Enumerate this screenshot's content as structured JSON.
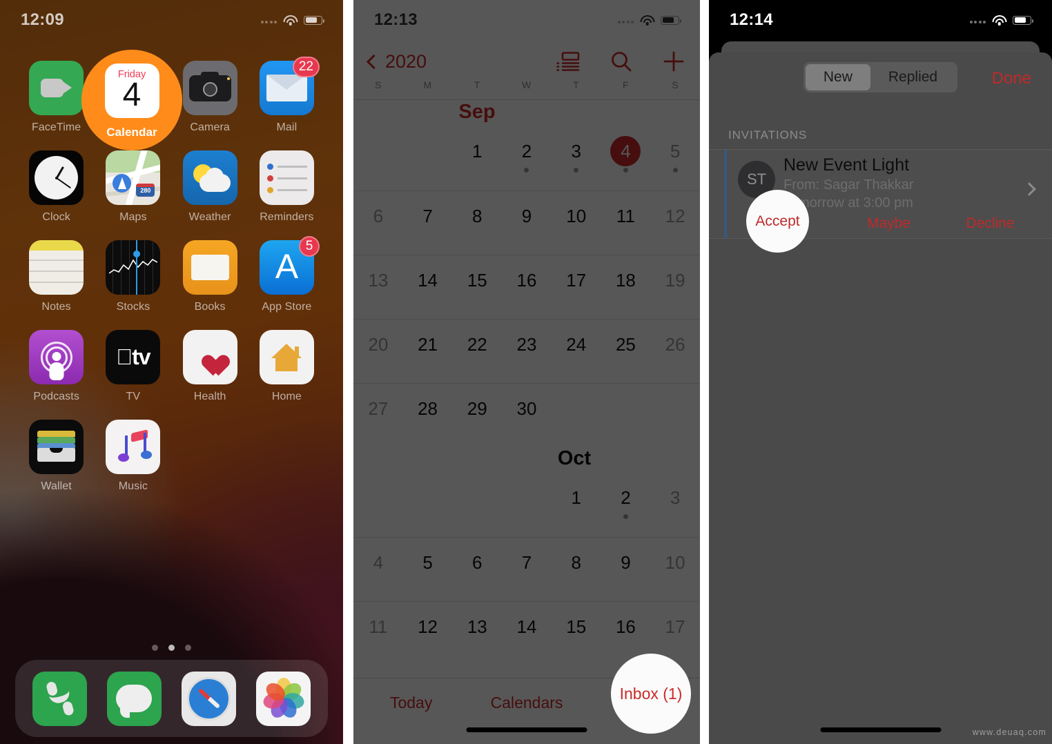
{
  "panel1": {
    "statusbar": {
      "time": "12:09",
      "wifi_icon": "wifi-icon",
      "battery_icon": "battery-icon",
      "signal_icon": "signal-dots-icon"
    },
    "apps": [
      {
        "name": "FaceTime",
        "icon": "facetime-icon"
      },
      {
        "name": "Calendar",
        "icon": "calendar-icon",
        "cal_day": "Friday",
        "cal_num": "4",
        "highlighted": true
      },
      {
        "name": "Camera",
        "icon": "camera-icon"
      },
      {
        "name": "Mail",
        "icon": "mail-icon",
        "badge": "22"
      },
      {
        "name": "Clock",
        "icon": "clock-icon"
      },
      {
        "name": "Maps",
        "icon": "maps-icon",
        "shield": "280"
      },
      {
        "name": "Weather",
        "icon": "weather-icon"
      },
      {
        "name": "Reminders",
        "icon": "reminders-icon"
      },
      {
        "name": "Notes",
        "icon": "notes-icon"
      },
      {
        "name": "Stocks",
        "icon": "stocks-icon"
      },
      {
        "name": "Books",
        "icon": "books-icon"
      },
      {
        "name": "App Store",
        "icon": "appstore-icon",
        "badge": "5"
      },
      {
        "name": "Podcasts",
        "icon": "podcasts-icon"
      },
      {
        "name": "TV",
        "icon": "tv-icon",
        "glyph": "tv"
      },
      {
        "name": "Health",
        "icon": "health-icon"
      },
      {
        "name": "Home",
        "icon": "home-icon"
      },
      {
        "name": "Wallet",
        "icon": "wallet-icon"
      },
      {
        "name": "Music",
        "icon": "music-icon"
      }
    ],
    "page_dots": {
      "count": 3,
      "active_index": 1
    },
    "dock": [
      {
        "name": "Phone",
        "icon": "phone-icon"
      },
      {
        "name": "Messages",
        "icon": "messages-icon"
      },
      {
        "name": "Safari",
        "icon": "safari-icon"
      },
      {
        "name": "Photos",
        "icon": "photos-icon"
      }
    ],
    "highlight": {
      "target": "Calendar",
      "color": "#ff8c1a"
    }
  },
  "panel2": {
    "statusbar": {
      "time": "12:13"
    },
    "nav": {
      "back_label": "2020",
      "back_icon": "chevron-left-icon",
      "list_view_icon": "agenda-list-icon",
      "search_icon": "search-icon",
      "add_icon": "plus-icon"
    },
    "weekdays": [
      "S",
      "M",
      "T",
      "W",
      "T",
      "F",
      "S"
    ],
    "months": [
      {
        "name": "Sep",
        "accent": true,
        "weeks": [
          [
            {
              "n": "",
              "dim": false
            },
            {
              "n": "",
              "dim": false
            },
            {
              "n": "1",
              "dim": false
            },
            {
              "n": "2",
              "dim": false,
              "dot": true
            },
            {
              "n": "3",
              "dim": false,
              "dot": true
            },
            {
              "n": "4",
              "dim": false,
              "dot": true,
              "today": true
            },
            {
              "n": "5",
              "dim": true,
              "dot": true
            }
          ],
          [
            {
              "n": "6",
              "dim": true
            },
            {
              "n": "7",
              "dim": false
            },
            {
              "n": "8",
              "dim": false
            },
            {
              "n": "9",
              "dim": false
            },
            {
              "n": "10",
              "dim": false
            },
            {
              "n": "11",
              "dim": false
            },
            {
              "n": "12",
              "dim": true
            }
          ],
          [
            {
              "n": "13",
              "dim": true
            },
            {
              "n": "14",
              "dim": false
            },
            {
              "n": "15",
              "dim": false
            },
            {
              "n": "16",
              "dim": false
            },
            {
              "n": "17",
              "dim": false
            },
            {
              "n": "18",
              "dim": false
            },
            {
              "n": "19",
              "dim": true
            }
          ],
          [
            {
              "n": "20",
              "dim": true
            },
            {
              "n": "21",
              "dim": false
            },
            {
              "n": "22",
              "dim": false
            },
            {
              "n": "23",
              "dim": false
            },
            {
              "n": "24",
              "dim": false
            },
            {
              "n": "25",
              "dim": false
            },
            {
              "n": "26",
              "dim": true
            }
          ],
          [
            {
              "n": "27",
              "dim": true
            },
            {
              "n": "28",
              "dim": false
            },
            {
              "n": "29",
              "dim": false
            },
            {
              "n": "30",
              "dim": false
            },
            {
              "n": "",
              "dim": false
            },
            {
              "n": "",
              "dim": false
            },
            {
              "n": "",
              "dim": false
            }
          ]
        ]
      },
      {
        "name": "Oct",
        "accent": false,
        "weeks": [
          [
            {
              "n": "",
              "dim": false
            },
            {
              "n": "",
              "dim": false
            },
            {
              "n": "",
              "dim": false
            },
            {
              "n": "",
              "dim": false
            },
            {
              "n": "1",
              "dim": false
            },
            {
              "n": "2",
              "dim": false,
              "dot": true
            },
            {
              "n": "3",
              "dim": true
            }
          ],
          [
            {
              "n": "4",
              "dim": true
            },
            {
              "n": "5",
              "dim": false
            },
            {
              "n": "6",
              "dim": false
            },
            {
              "n": "7",
              "dim": false
            },
            {
              "n": "8",
              "dim": false
            },
            {
              "n": "9",
              "dim": false
            },
            {
              "n": "10",
              "dim": true
            }
          ],
          [
            {
              "n": "11",
              "dim": true
            },
            {
              "n": "12",
              "dim": false
            },
            {
              "n": "13",
              "dim": false
            },
            {
              "n": "14",
              "dim": false
            },
            {
              "n": "15",
              "dim": false
            },
            {
              "n": "16",
              "dim": false
            },
            {
              "n": "17",
              "dim": true
            }
          ]
        ]
      }
    ],
    "tabbar": {
      "today": "Today",
      "calendars": "Calendars",
      "inbox": "Inbox (1)"
    },
    "highlight": {
      "target": "Inbox (1)"
    }
  },
  "panel3": {
    "statusbar": {
      "time": "12:14"
    },
    "segmented": {
      "options": [
        "New",
        "Replied"
      ],
      "selected": "New"
    },
    "done_label": "Done",
    "section_header": "INVITATIONS",
    "invitation": {
      "avatar_initials": "ST",
      "title": "New Event Light",
      "from": "From: Sagar Thakkar",
      "when": "Tomorrow at 3:00 pm",
      "disclosure_icon": "chevron-right-icon",
      "actions": [
        "Accept",
        "Maybe",
        "Decline"
      ]
    },
    "highlight": {
      "target": "Accept"
    }
  },
  "watermark": "www.deuaq.com"
}
